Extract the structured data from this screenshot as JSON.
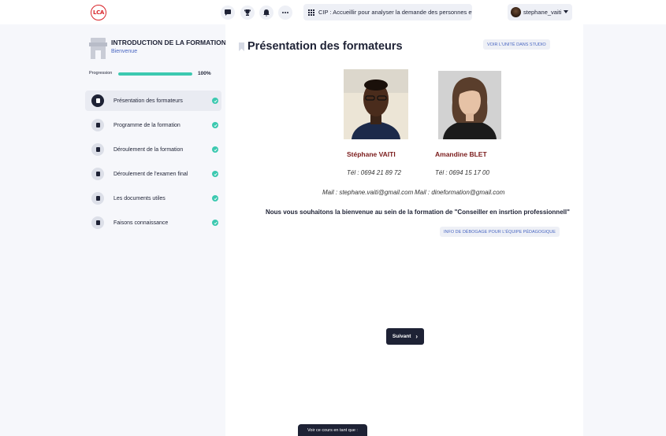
{
  "topbar": {
    "logo_text": "LCA",
    "icons": [
      "chat-icon",
      "trophy-icon",
      "bell-icon",
      "more-icon"
    ],
    "course_select": "CIP : Accueillir pour analyser la demande des personnes et po...",
    "username": "stephane_vaiti"
  },
  "sidebar": {
    "module_title": "INTRODUCTION DE LA FORMATION",
    "module_subtitle": "Bienvenue",
    "progress_label": "Progression",
    "progress_value": "100%",
    "progress_fraction": 1.0,
    "items": [
      {
        "label": "Présentation des formateurs",
        "active": true,
        "completed": true
      },
      {
        "label": "Programme de la formation",
        "active": false,
        "completed": true
      },
      {
        "label": "Déroulement de la formation",
        "active": false,
        "completed": true
      },
      {
        "label": "Déroulement de l'examen final",
        "active": false,
        "completed": true
      },
      {
        "label": "Les documents utiles",
        "active": false,
        "completed": true
      },
      {
        "label": "Faisons connaissance",
        "active": false,
        "completed": true
      }
    ]
  },
  "main": {
    "title": "Présentation des formateurs",
    "studio_button": "VOIR L'UNITÉ DANS STUDIO",
    "trainers": [
      {
        "name": "Stéphane VAITI",
        "phone": "Tél : 0694 21 89 72",
        "mail": "Mail : stephane.vaiti@gmail.com"
      },
      {
        "name": "Amandine BLET",
        "phone": "Tél : 0694 15 17 00",
        "mail": "Mail : dineformation@gmail.com"
      }
    ],
    "welcome": "Nous vous souhaitons la bienvenue au sein de la formation de \"Conseiller en insrtion professionnell\"",
    "debug_button": "INFO DE DÉBOGAGE POUR L'ÉQUIPE PÉDAGOGIQUE",
    "next_button": "Suivant"
  },
  "preview_bar": "Voir ce cours en tant que :",
  "colors": {
    "accent": "#3cc9b0",
    "dark": "#1e2235",
    "link": "#4a67c2",
    "trainer_name": "#7a1b1b"
  }
}
